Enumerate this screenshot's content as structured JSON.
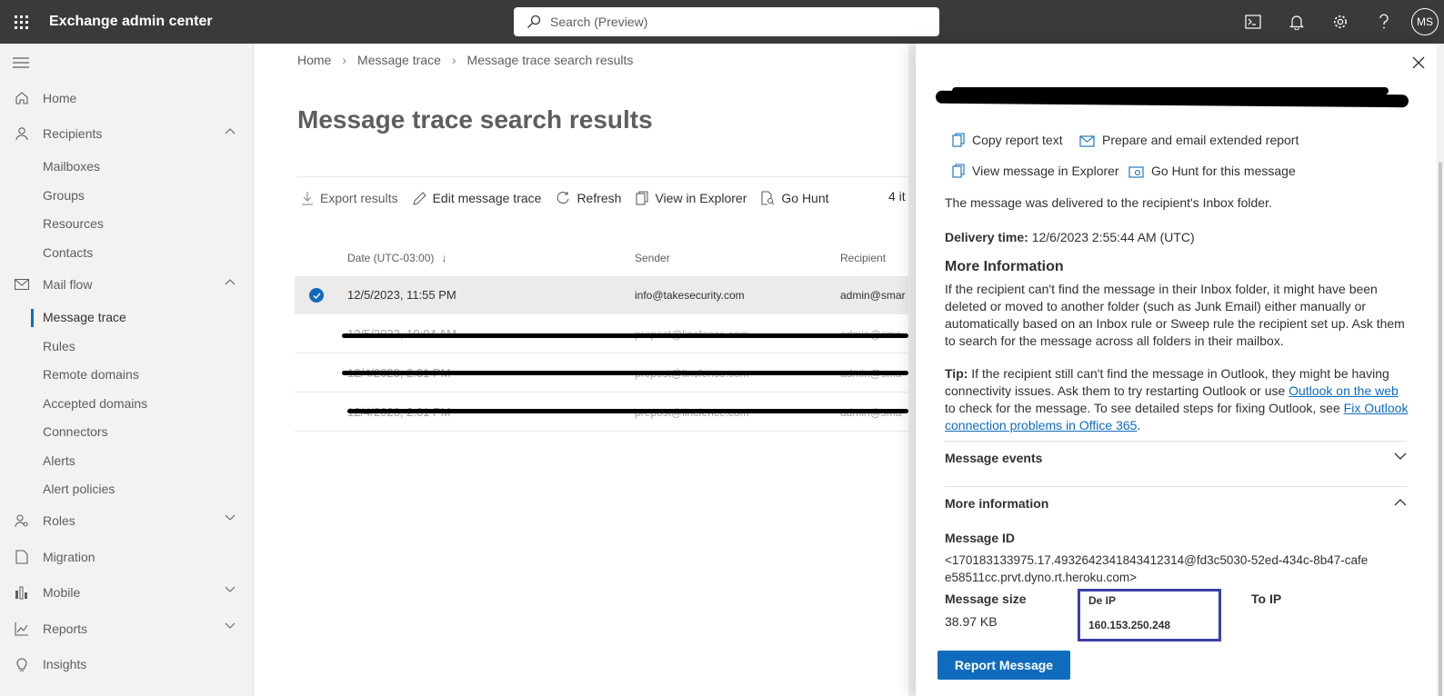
{
  "app": {
    "title": "Exchange admin center",
    "avatar_initials": "MS"
  },
  "search": {
    "placeholder": "Search (Preview)"
  },
  "topbar_icons": [
    "terminal-icon",
    "bell-icon",
    "gear-icon",
    "help-icon"
  ],
  "sidebar": {
    "home": "Home",
    "recipients": "Recipients",
    "recipients_sub": [
      "Mailboxes",
      "Groups",
      "Resources",
      "Contacts"
    ],
    "mail_flow": "Mail flow",
    "mail_flow_sub": [
      "Message trace",
      "Rules",
      "Remote domains",
      "Accepted domains",
      "Connectors",
      "Alerts",
      "Alert policies"
    ],
    "roles": "Roles",
    "migration": "Migration",
    "mobile": "Mobile",
    "reports": "Reports",
    "insights": "Insights"
  },
  "breadcrumb": [
    "Home",
    "Message trace",
    "Message trace search results"
  ],
  "page_title": "Message trace search results",
  "toolbar": {
    "export": "Export results",
    "edit": "Edit message trace",
    "refresh": "Refresh",
    "view_explorer": "View in Explorer",
    "go_hunt": "Go Hunt",
    "count": "4 it"
  },
  "table": {
    "headers": {
      "date": "Date (UTC-03:00)",
      "sender": "Sender",
      "recipient": "Recipient"
    },
    "rows": [
      {
        "date": "12/5/2023, 11:55 PM",
        "sender": "info@takesecurity.com",
        "recipient": "admin@smar"
      },
      {
        "date": "12/5/2023, 10:04 AM",
        "sender": "prepost@lincfence.com",
        "recipient": "admin@sma"
      },
      {
        "date": "12/4/2023, 2:31 PM",
        "sender": "prepost@lincfence.com",
        "recipient": "admin@sma"
      },
      {
        "date": "12/4/2023, 2:31 PM",
        "sender": "prepost@lincfence.com",
        "recipient": "admin@sma"
      }
    ]
  },
  "panel": {
    "actions": {
      "copy": "Copy report text",
      "prepare": "Prepare and email extended report",
      "view_explorer": "View message in Explorer",
      "go_hunt": "Go Hunt for this message"
    },
    "delivered_text": "The message was delivered to the recipient's Inbox folder.",
    "delivery_label": "Delivery time:",
    "delivery_value": "12/6/2023 2:55:44 AM (UTC)",
    "more_info_title": "More Information",
    "more_info_text": "If the recipient can't find the message in their Inbox folder, it might have been deleted or moved to another folder (such as Junk Email) either manually or automatically based on an Inbox rule or Sweep rule the recipient set up. Ask them to search for the message across all folders in their mailbox.",
    "tip_label": "Tip:",
    "tip_text_1": "If the recipient still can't find the message in Outlook, they might be having connectivity issues. Ask them to try restarting Outlook or use",
    "tip_link_1": "Outlook on the web",
    "tip_text_2": "to check for the message. To see detailed steps for fixing Outlook, see",
    "tip_link_2": "Fix Outlook connection problems in Office 365",
    "tip_text_3": ".",
    "section_events": "Message events",
    "section_more": "More information",
    "message_id_label": "Message ID",
    "message_id_value": "<170183133975.17.4932642341843412314@fd3c5030-52ed-434c-8b47-cafee58511cc.prvt.dyno.rt.heroku.com>",
    "size_label": "Message size",
    "size_value": "38.97 KB",
    "from_ip_label": "De IP",
    "from_ip_value": "160.153.250.248",
    "to_ip_label": "To IP",
    "report_button": "Report Message"
  },
  "colors": {
    "topbar": "#3b3a39",
    "accent": "#0f6cbd",
    "highlight_box": "#3b40a8"
  }
}
